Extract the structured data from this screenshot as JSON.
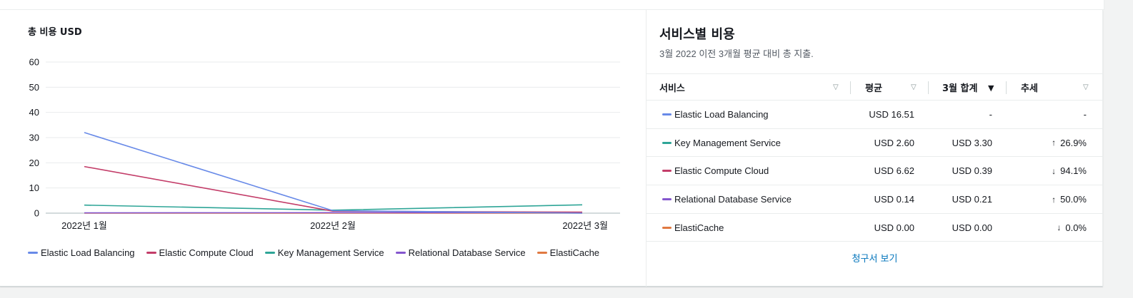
{
  "left_panel": {
    "title": "총 비용 USD",
    "chart_data": {
      "type": "line",
      "title": "총 비용 USD",
      "x": [
        "2022년 1월",
        "2022년 2월",
        "2022년 3월"
      ],
      "y_ticks": [
        "0",
        "10",
        "20",
        "30",
        "40",
        "50",
        "60"
      ],
      "ylim": [
        0,
        60
      ],
      "grid": true,
      "legend_position": "bottom",
      "series": [
        {
          "name": "Elastic Load Balancing",
          "color": "#688ae8",
          "values": [
            32,
            1,
            0
          ]
        },
        {
          "name": "Elastic Compute Cloud",
          "color": "#c33d69",
          "values": [
            18.5,
            0.8,
            0.4
          ]
        },
        {
          "name": "Key Management Service",
          "color": "#2ea597",
          "values": [
            3.2,
            1.2,
            3.3
          ]
        },
        {
          "name": "Relational Database Service",
          "color": "#8456ce",
          "values": [
            0.1,
            0.2,
            0.2
          ]
        },
        {
          "name": "ElastiCache",
          "color": "#e07941",
          "values": [
            0,
            0,
            0
          ]
        }
      ]
    }
  },
  "right_panel": {
    "title": "서비스별 비용",
    "subtitle": "3월 2022 이전 3개월 평균 대비 총 지출.",
    "columns": {
      "service": "서비스",
      "average": "평균",
      "total": "3월 합계",
      "trend": "추세"
    },
    "rows": [
      {
        "service": "Elastic Load Balancing",
        "color": "#688ae8",
        "average": "USD 16.51",
        "total": "-",
        "trend_arrow": "",
        "trend": "-"
      },
      {
        "service": "Key Management Service",
        "color": "#2ea597",
        "average": "USD 2.60",
        "total": "USD 3.30",
        "trend_arrow": "↑",
        "trend": "26.9%"
      },
      {
        "service": "Elastic Compute Cloud",
        "color": "#c33d69",
        "average": "USD 6.62",
        "total": "USD 0.39",
        "trend_arrow": "↓",
        "trend": "94.1%"
      },
      {
        "service": "Relational Database Service",
        "color": "#8456ce",
        "average": "USD 0.14",
        "total": "USD 0.21",
        "trend_arrow": "↑",
        "trend": "50.0%"
      },
      {
        "service": "ElastiCache",
        "color": "#e07941",
        "average": "USD 0.00",
        "total": "USD 0.00",
        "trend_arrow": "↓",
        "trend": "0.0%"
      }
    ],
    "icons": {
      "sort": "sort-icon",
      "sort_desc": "sort-descending-icon"
    },
    "bill_link": "청구서 보기"
  }
}
